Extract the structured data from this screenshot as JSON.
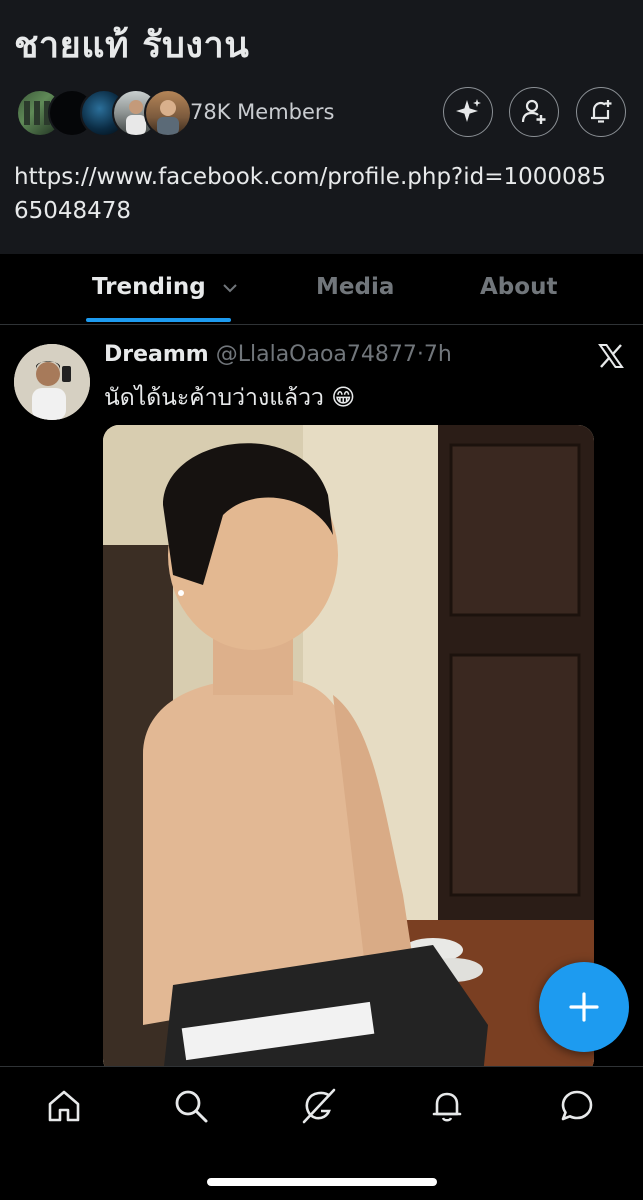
{
  "community": {
    "title": "ชายแท้ รับงาน",
    "members_label": "78K Members",
    "description": "https://www.facebook.com/profile.php?id=100008565048478",
    "actions": [
      "sparkle-icon",
      "add-member-icon",
      "notification-bell-icon"
    ]
  },
  "tabs": [
    {
      "label": "Trending",
      "active": true,
      "has_dropdown": true
    },
    {
      "label": "Media",
      "active": false
    },
    {
      "label": "About",
      "active": false
    }
  ],
  "post": {
    "author_name": "Dreamm",
    "author_handle": "@LlalaOaoa74877",
    "separator": "·",
    "time": "7h",
    "text": "นัดได้นะค้าบว่างแล้วว",
    "emoji": "😁",
    "source_icon": "x-logo-icon"
  },
  "bottom_nav": [
    "home-icon",
    "search-icon",
    "grok-icon",
    "notifications-icon",
    "messages-icon"
  ],
  "colors": {
    "accent": "#1d9bf0",
    "header_bg": "#16181c",
    "background": "#000000",
    "muted_text": "#71767b",
    "primary_text": "#e7e9ea"
  }
}
